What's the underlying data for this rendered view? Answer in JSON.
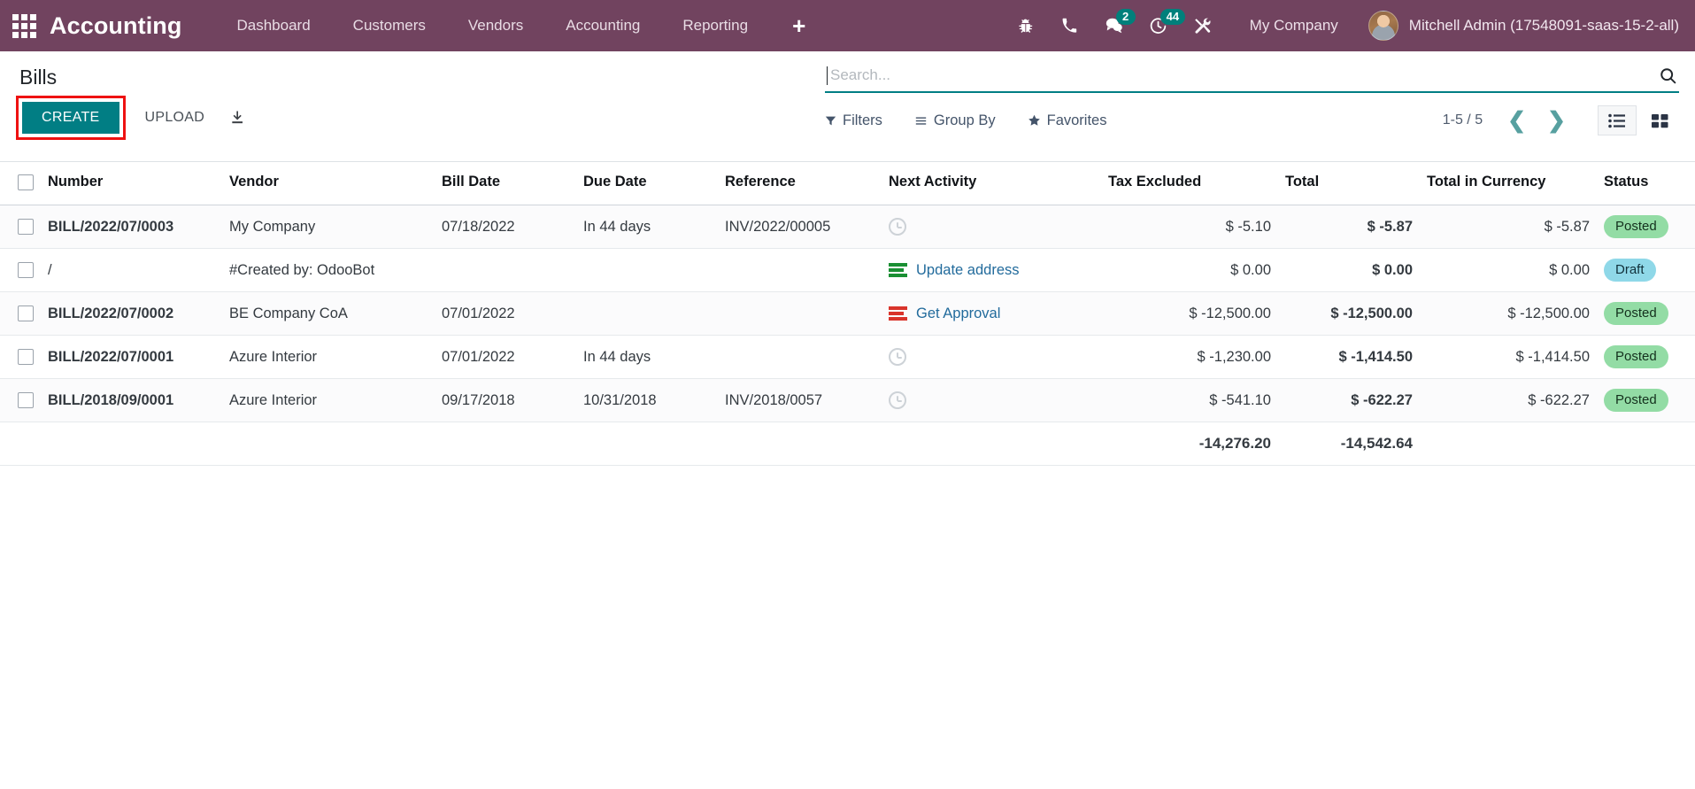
{
  "navbar": {
    "apps_icon": "apps-grid-icon",
    "brand": "Accounting",
    "menu": [
      {
        "label": "Dashboard"
      },
      {
        "label": "Customers"
      },
      {
        "label": "Vendors"
      },
      {
        "label": "Accounting"
      },
      {
        "label": "Reporting"
      }
    ],
    "plus_label": "+",
    "icons": [
      {
        "name": "bug-icon",
        "badge": null
      },
      {
        "name": "phone-icon",
        "badge": null
      },
      {
        "name": "messages-icon",
        "badge": "2"
      },
      {
        "name": "activity-clock-icon",
        "badge": "44"
      },
      {
        "name": "tools-icon",
        "badge": null
      }
    ],
    "company": "My Company",
    "user": "Mitchell Admin (17548091-saas-15-2-all)",
    "avatar_icon": "user-avatar",
    "bg_color": "#71435f",
    "badge_color": "#00807b"
  },
  "control_panel": {
    "title": "Bills",
    "create_label": "CREATE",
    "upload_label": "UPLOAD",
    "download_icon": "download-icon",
    "create_highlight_color": "#ee1111",
    "create_button_color": "#017e84"
  },
  "search": {
    "placeholder": "Search...",
    "value": "",
    "search_icon": "search-icon",
    "underline_color": "#017e84"
  },
  "filters": [
    {
      "name": "filters",
      "label": "Filters",
      "icon": "funnel-icon"
    },
    {
      "name": "group-by",
      "label": "Group By",
      "icon": "list-lines-icon"
    },
    {
      "name": "favorites",
      "label": "Favorites",
      "icon": "star-icon"
    }
  ],
  "pager": {
    "range": "1-5 / 5",
    "prev_icon": "chevron-left-icon",
    "next_icon": "chevron-right-icon"
  },
  "view_switch": [
    {
      "name": "list-view",
      "icon": "list-view-icon",
      "active": true
    },
    {
      "name": "kanban-view",
      "icon": "kanban-view-icon",
      "active": false
    }
  ],
  "table": {
    "columns": [
      "Number",
      "Vendor",
      "Bill Date",
      "Due Date",
      "Reference",
      "Next Activity",
      "Tax Excluded",
      "Total",
      "Total in Currency",
      "Status"
    ],
    "optional_columns_icon": "vertical-ellipsis-icon",
    "rows": [
      {
        "number": "BILL/2022/07/0003",
        "vendor": "My Company",
        "vendor_link": false,
        "bill_date": "07/18/2022",
        "due_date": "In 44 days",
        "due_overdue": false,
        "reference": "INV/2022/00005",
        "activity_icon": "clock-icon",
        "activity_icon_color": "grey",
        "activity_label": "",
        "tax_excluded": "$ -5.10",
        "total": "$ -5.87",
        "total_in_currency": "$ -5.87",
        "status": "Posted",
        "status_type": "posted"
      },
      {
        "number": "/",
        "vendor": "#Created by: OdooBot",
        "vendor_link": true,
        "bill_date": "",
        "due_date": "",
        "due_overdue": false,
        "reference": "",
        "activity_icon": "activity-bars-icon",
        "activity_icon_color": "green",
        "activity_label": "Update address",
        "tax_excluded": "$ 0.00",
        "total": "$ 0.00",
        "total_in_currency": "$ 0.00",
        "status": "Draft",
        "status_type": "draft"
      },
      {
        "number": "BILL/2022/07/0002",
        "vendor": "BE Company CoA",
        "vendor_link": false,
        "bill_date": "07/01/2022",
        "due_date": "",
        "due_overdue": false,
        "reference": "",
        "activity_icon": "activity-bars-icon",
        "activity_icon_color": "red",
        "activity_label": "Get Approval",
        "tax_excluded": "$ -12,500.00",
        "total": "$ -12,500.00",
        "total_in_currency": "$ -12,500.00",
        "status": "Posted",
        "status_type": "posted"
      },
      {
        "number": "BILL/2022/07/0001",
        "vendor": "Azure Interior",
        "vendor_link": false,
        "bill_date": "07/01/2022",
        "due_date": "In 44 days",
        "due_overdue": false,
        "reference": "",
        "activity_icon": "clock-icon",
        "activity_icon_color": "grey",
        "activity_label": "",
        "tax_excluded": "$ -1,230.00",
        "total": "$ -1,414.50",
        "total_in_currency": "$ -1,414.50",
        "status": "Posted",
        "status_type": "posted"
      },
      {
        "number": "BILL/2018/09/0001",
        "vendor": "Azure Interior",
        "vendor_link": false,
        "bill_date": "09/17/2018",
        "due_date": "10/31/2018",
        "due_overdue": true,
        "reference": "INV/2018/0057",
        "activity_icon": "clock-icon",
        "activity_icon_color": "grey",
        "activity_label": "",
        "tax_excluded": "$ -541.10",
        "total": "$ -622.27",
        "total_in_currency": "$ -622.27",
        "status": "Posted",
        "status_type": "posted"
      }
    ],
    "totals": {
      "tax_excluded": "-14,276.20",
      "total": "-14,542.64",
      "total_in_currency": ""
    }
  },
  "colors": {
    "posted_badge": "#93dca5",
    "draft_badge": "#8fd8e8",
    "overdue_text": "#dc3545",
    "link_text": "#226b9c"
  }
}
